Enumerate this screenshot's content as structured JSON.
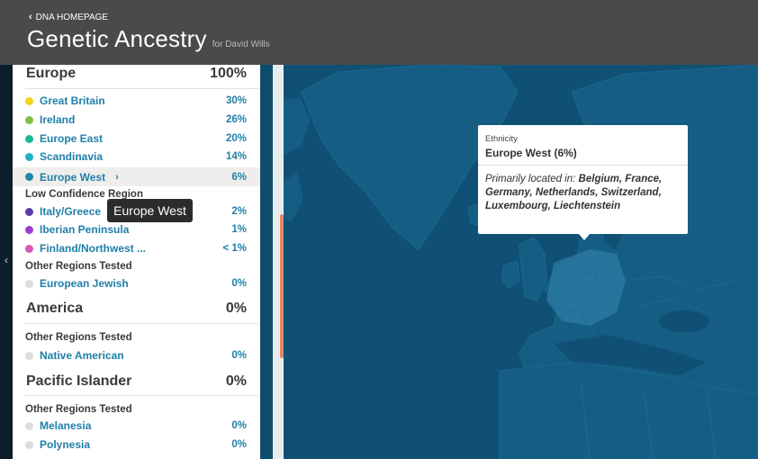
{
  "header": {
    "back_label": "DNA HOMEPAGE",
    "title": "Genetic Ancestry",
    "subtitle": "for David Wills"
  },
  "sidebar": {
    "europe": {
      "name": "Europe",
      "percent": "100%",
      "items": [
        {
          "label": "Great Britain",
          "percent": "30%",
          "color": "#f2d21b"
        },
        {
          "label": "Ireland",
          "percent": "26%",
          "color": "#7cc242"
        },
        {
          "label": "Europe East",
          "percent": "20%",
          "color": "#19b799"
        },
        {
          "label": "Scandinavia",
          "percent": "14%",
          "color": "#20b3c8"
        },
        {
          "label": "Europe West",
          "percent": "6%",
          "color": "#1d8aa5"
        }
      ],
      "low_confidence_label": "Low Confidence Region",
      "low_items": [
        {
          "label": "Italy/Greece",
          "percent": "2%",
          "color": "#5a3ea8"
        },
        {
          "label": "Iberian Peninsula",
          "percent": "1%",
          "color": "#9b3fcf"
        },
        {
          "label": "Finland/Northwest ...",
          "percent": "< 1%",
          "color": "#d957b7"
        }
      ],
      "other_label": "Other Regions Tested",
      "other_items": [
        {
          "label": "European Jewish",
          "percent": "0%",
          "color": "#dddddd"
        }
      ]
    },
    "america": {
      "name": "America",
      "percent": "0%",
      "other_label": "Other Regions Tested",
      "other_items": [
        {
          "label": "Native American",
          "percent": "0%",
          "color": "#dddddd"
        }
      ]
    },
    "pacific": {
      "name": "Pacific Islander",
      "percent": "0%",
      "other_label": "Other Regions Tested",
      "other_items": [
        {
          "label": "Melanesia",
          "percent": "0%",
          "color": "#dddddd"
        },
        {
          "label": "Polynesia",
          "percent": "0%",
          "color": "#dddddd"
        }
      ]
    }
  },
  "tooltip": {
    "text": "Europe West"
  },
  "popup": {
    "kicker": "Ethnicity",
    "title": "Europe West (6%)",
    "body_prefix": "Primarily located in:",
    "body_places": "Belgium, France, Germany, Netherlands, Switzerland, Luxembourg, Liechtenstein"
  },
  "colors": {
    "header_bg": "#4a4a4a",
    "map_water": "#0f5074",
    "map_land": "#155d83",
    "highlight": "#2e7ea5",
    "link": "#1f7fa8"
  }
}
